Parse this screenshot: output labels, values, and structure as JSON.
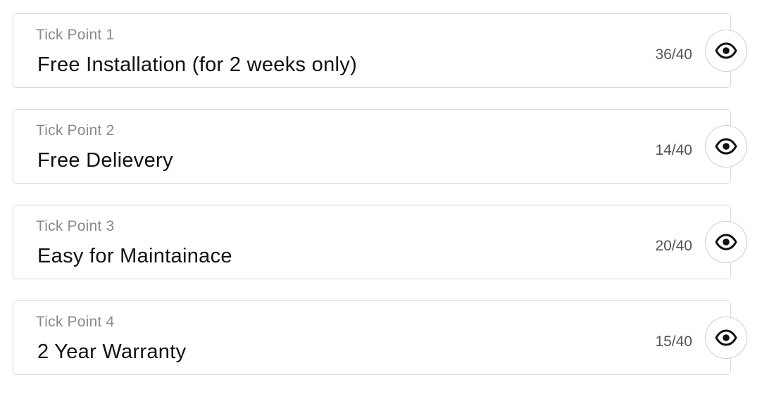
{
  "tick_points": [
    {
      "label": "Tick Point 1",
      "value": "Free Installation (for 2 weeks only)",
      "count": "36/40",
      "action_icon": "eye-icon"
    },
    {
      "label": "Tick Point 2",
      "value": "Free Delievery",
      "count": "14/40",
      "action_icon": "eye-icon"
    },
    {
      "label": "Tick Point 3",
      "value": "Easy for Maintainace",
      "count": "20/40",
      "action_icon": "eye-icon"
    },
    {
      "label": "Tick Point 4",
      "value": "2 Year Warranty",
      "count": "15/40",
      "action_icon": "eye-icon"
    }
  ],
  "colors": {
    "border": "#d9d9d9",
    "label": "#8a8a8a",
    "value": "#111111",
    "icon": "#111111"
  }
}
